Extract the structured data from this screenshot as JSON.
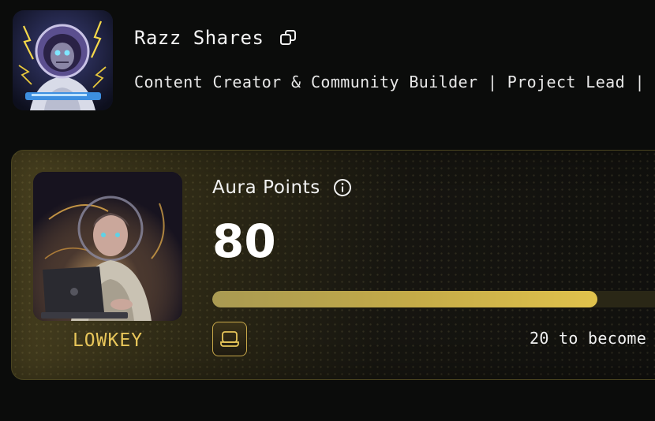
{
  "profile": {
    "name": "Razz Shares",
    "bio": "Content Creator & Community Builder | Project Lead |",
    "avatar_icon": "astronaut-avatar",
    "copy_icon": "copy-icon"
  },
  "aura": {
    "label": "Aura Points",
    "info_icon": "info-icon",
    "points": "80",
    "progress_fraction": 0.8,
    "rank_name": "LOWKEY",
    "rank_icon": "laptop-icon",
    "next_rank_text": "20 to become",
    "accent_color": "#e8c65a"
  }
}
